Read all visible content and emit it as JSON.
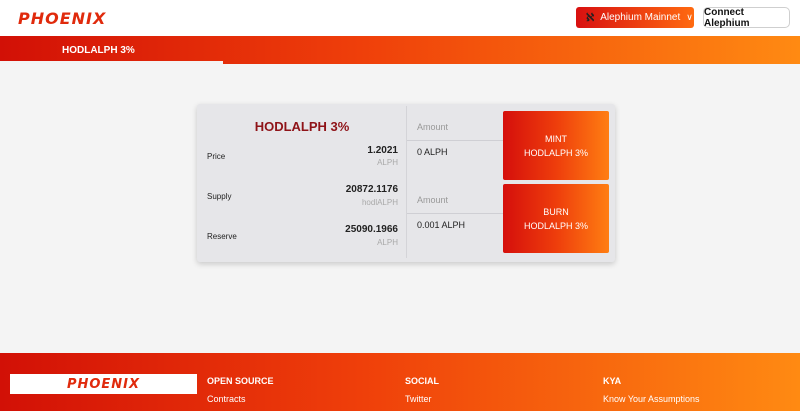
{
  "header": {
    "logo": "PHOENIX",
    "network_icon_text": "ℵ",
    "network_label": "Alephium Mainnet",
    "connect_label": "Connect Alephium"
  },
  "tabs": [
    {
      "label": "HODLALPH 3%",
      "active": true
    }
  ],
  "card": {
    "title": "HODLALPH 3%",
    "stats": [
      {
        "label": "Price",
        "value": "1.2021",
        "unit": "ALPH"
      },
      {
        "label": "Supply",
        "value": "20872.1176",
        "unit": "hodlALPH"
      },
      {
        "label": "Reserve",
        "value": "25090.1966",
        "unit": "ALPH"
      }
    ],
    "mint": {
      "amount_label": "Amount",
      "amount_value": "0 ALPH",
      "button_line1": "MINT",
      "button_line2": "HODLALPH 3%"
    },
    "burn": {
      "amount_label": "Amount",
      "amount_value": "0.001 ALPH",
      "button_line1": "BURN",
      "button_line2": "HODLALPH 3%"
    }
  },
  "footer": {
    "logo": "PHOENIX",
    "columns": [
      {
        "title": "OPEN SOURCE",
        "link": "Contracts"
      },
      {
        "title": "SOCIAL",
        "link": "Twitter"
      },
      {
        "title": "KYA",
        "link": "Know Your Assumptions"
      }
    ]
  },
  "colors": {
    "accent_red": "#d21006",
    "accent_orange": "#ff8a12",
    "title_dark_red": "#8f1318"
  }
}
